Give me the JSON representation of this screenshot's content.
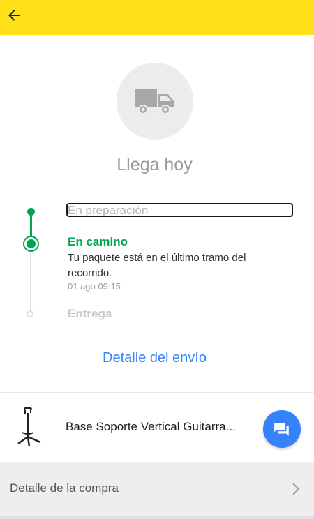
{
  "header": {
    "background_color": "#FFE01B",
    "back_icon": "arrow-left-icon"
  },
  "status": {
    "icon": "truck-icon",
    "title": "Llega hoy"
  },
  "timeline": {
    "steps": [
      {
        "label": "En preparación",
        "state": "done"
      },
      {
        "label": "En camino",
        "state": "current",
        "description": "Tu paquete está en el último tramo del recorrido.",
        "date": "01 ago 09:15"
      },
      {
        "label": "Entrega",
        "state": "pending"
      }
    ],
    "active_color": "#00a650"
  },
  "shipping_detail_link": "Detalle del envío",
  "product": {
    "name": "Base Soporte Vertical Guitarra...",
    "image_icon": "guitar-stand-icon",
    "chat_icon": "chat-icon"
  },
  "purchase_detail": {
    "label": "Detalle de la compra",
    "chevron_icon": "chevron-right-icon"
  },
  "colors": {
    "link": "#3483fa"
  }
}
